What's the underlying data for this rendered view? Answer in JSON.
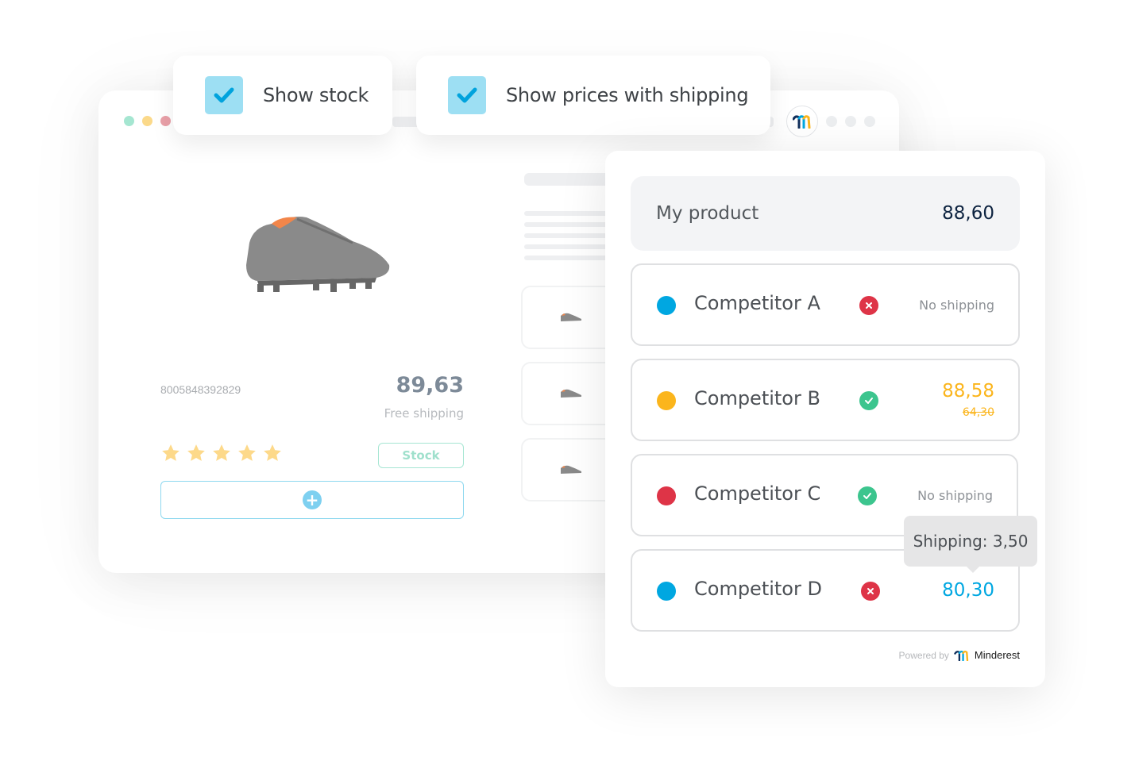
{
  "options": {
    "show_stock": {
      "label": "Show stock",
      "checked": true
    },
    "show_shipping": {
      "label": "Show prices with shipping",
      "checked": true
    }
  },
  "browser": {
    "window_dots": [
      "#a5e6d1",
      "#fbd98a",
      "#e9a0a8"
    ],
    "product": {
      "ean": "8005848392829",
      "price": "89,63",
      "shipping_note": "Free shipping",
      "rating": 5,
      "rating_max": 5,
      "stock_label": "Stock",
      "add_symbol": "+"
    },
    "thumbnails": [
      "shoe-thumbnail",
      "shoe-thumbnail",
      "shoe-thumbnail"
    ]
  },
  "panel": {
    "my_product": {
      "label": "My product",
      "price": "88,60"
    },
    "competitors": [
      {
        "name": "Competitor A",
        "dot_color": "#00a7e1",
        "status": "unavailable",
        "price": null,
        "old_price": null,
        "note": "No shipping"
      },
      {
        "name": "Competitor B",
        "dot_color": "#fbb51c",
        "status": "available",
        "price": "88,58",
        "old_price": "64,30",
        "note": null,
        "price_color": "#fbb51c"
      },
      {
        "name": "Competitor C",
        "dot_color": "#de3447",
        "status": "available",
        "price": null,
        "old_price": null,
        "note": "No shipping"
      },
      {
        "name": "Competitor D",
        "dot_color": "#00a7e1",
        "status": "unavailable",
        "price": "80,30",
        "old_price": null,
        "note": null,
        "price_color": "#00a7e1"
      }
    ],
    "tooltip": "Shipping: 3,50",
    "powered_by": "Powered by",
    "brand": "Minderest"
  },
  "colors": {
    "check_bg": "#9ddff3",
    "check_mark": "#00a3dd",
    "status_ok": "#3cc58e",
    "status_error": "#de3447",
    "star": "#fdd98a"
  }
}
